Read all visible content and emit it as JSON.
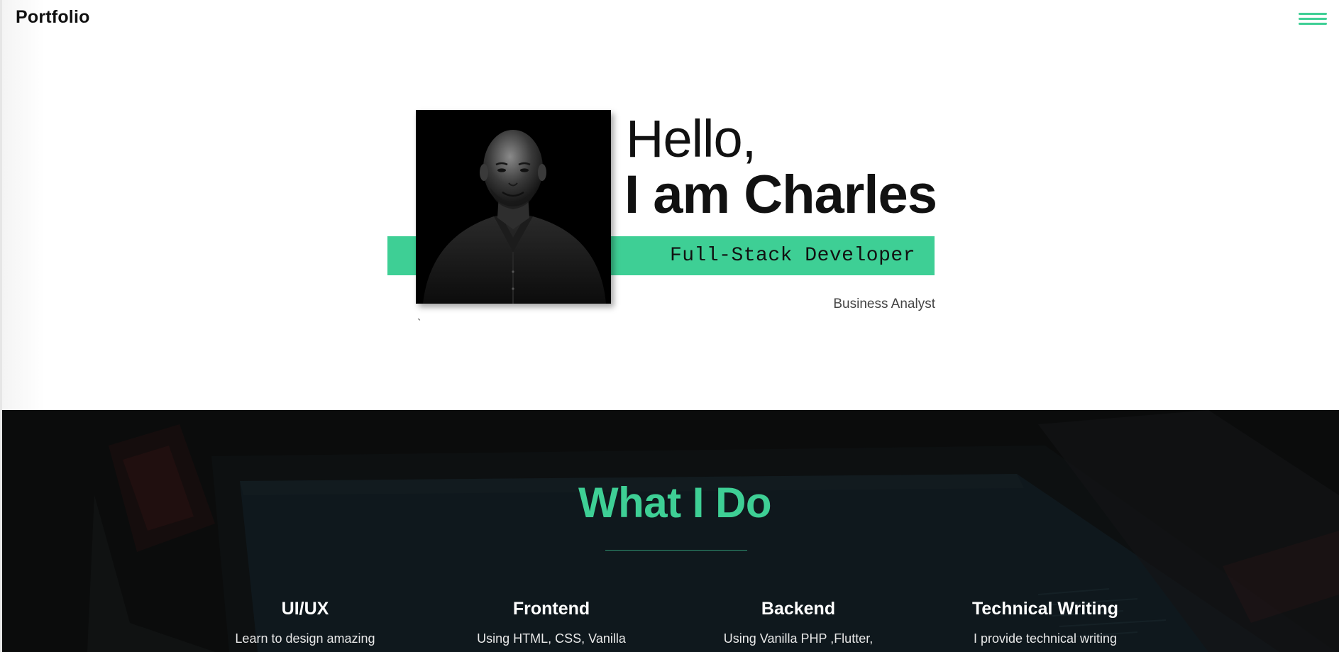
{
  "nav": {
    "brand": "Portfolio",
    "menu_icon": "hamburger-menu-icon"
  },
  "hero": {
    "greeting": "Hello,",
    "name": "I am Charles",
    "role": "Full-Stack Developer",
    "secondary_role": "Business Analyst",
    "stray_mark": "`",
    "portrait_alt": "portrait-photo"
  },
  "services": {
    "title": "What I Do",
    "items": [
      {
        "title": "UI/UX",
        "desc": "Learn to design amazing"
      },
      {
        "title": "Frontend",
        "desc": "Using HTML, CSS, Vanilla"
      },
      {
        "title": "Backend",
        "desc": "Using Vanilla PHP ,Flutter,"
      },
      {
        "title": "Technical Writing",
        "desc": "I provide technical writing"
      }
    ]
  },
  "colors": {
    "accent": "#3ecf95",
    "dark_section": "#0f1111",
    "text": "#111111"
  }
}
